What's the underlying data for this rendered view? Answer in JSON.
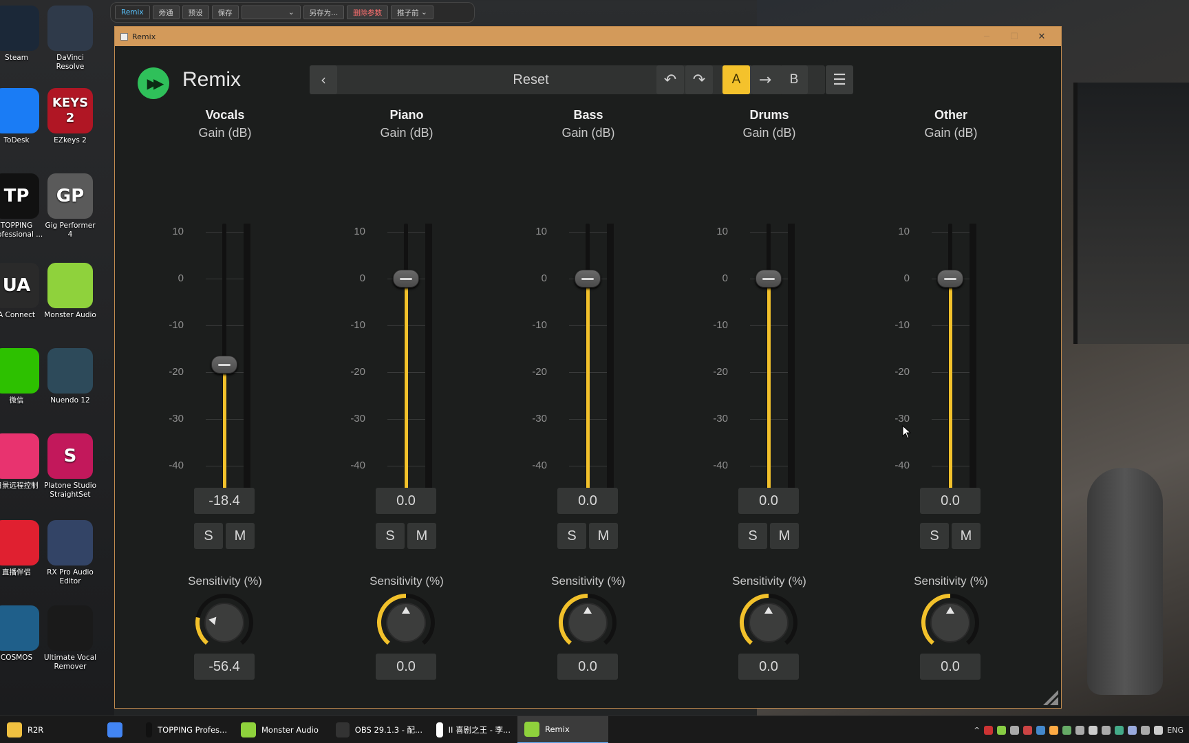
{
  "desktop": {
    "icons": [
      {
        "label": "Steam",
        "abbr": "",
        "color": "#1b2838"
      },
      {
        "label": "DaVinci Resolve",
        "abbr": "",
        "color": "#2f3a4a"
      },
      {
        "label": "ToDesk",
        "abbr": "",
        "color": "#1a7cf5"
      },
      {
        "label": "EZkeys 2",
        "abbr": "KEYS 2",
        "color": "#b01624"
      },
      {
        "label": "TOPPING Professional ...",
        "abbr": "TP",
        "color": "#111111"
      },
      {
        "label": "Gig Performer 4",
        "abbr": "GP",
        "color": "#5a5a5a"
      },
      {
        "label": "A Connect",
        "abbr": "UA",
        "color": "#2a2a2a"
      },
      {
        "label": "Monster Audio",
        "abbr": "",
        "color": "#8fd23c"
      },
      {
        "label": "微信",
        "abbr": "",
        "color": "#2dc100"
      },
      {
        "label": "Nuendo 12",
        "abbr": "",
        "color": "#2d4a5a"
      },
      {
        "label": "日景远程控制",
        "abbr": "",
        "color": "#e8336f"
      },
      {
        "label": "Platone Studio StraightSet",
        "abbr": "S",
        "color": "#c2185b"
      },
      {
        "label": "直播伴侣",
        "abbr": "",
        "color": "#e02030"
      },
      {
        "label": "RX Pro Audio Editor",
        "abbr": "",
        "color": "#334466"
      },
      {
        "label": "COSMOS",
        "abbr": "",
        "color": "#1f5f8a"
      },
      {
        "label": "Ultimate Vocal Remover",
        "abbr": "",
        "color": "#1a1a1a"
      }
    ]
  },
  "host_bar": {
    "buttons": [
      "Remix",
      "旁通",
      "预设",
      "保存",
      "",
      "另存为...",
      "删除参数",
      "推子前"
    ]
  },
  "window": {
    "title": "Remix",
    "controls": {
      "minimize": "─",
      "maximize": "☐",
      "close": "✕"
    }
  },
  "plugin": {
    "name": "Remix",
    "preset": "Reset",
    "buttons": {
      "prev": "‹",
      "next": "›",
      "search": "search-icon",
      "undo": "↶",
      "redo": "↷",
      "ab_a": "A",
      "ab_copy": "→",
      "ab_b": "B",
      "menu": "☰"
    },
    "accent": "#f2c12b",
    "logo_color": "#2fc05a"
  },
  "scale": [
    "10",
    "0",
    "-10",
    "-20",
    "-30",
    "-40"
  ],
  "meter_dash": "--",
  "channels": [
    {
      "name": "Vocals",
      "unit": "Gain (dB)",
      "gain": "-18.4",
      "gain_db": -18.4,
      "solo": "S",
      "mute": "M",
      "sens_label": "Sensitivity (%)",
      "sensitivity": "-56.4",
      "sens_pct": -56.4
    },
    {
      "name": "Piano",
      "unit": "Gain (dB)",
      "gain": "0.0",
      "gain_db": 0,
      "solo": "S",
      "mute": "M",
      "sens_label": "Sensitivity (%)",
      "sensitivity": "0.0",
      "sens_pct": 0
    },
    {
      "name": "Bass",
      "unit": "Gain (dB)",
      "gain": "0.0",
      "gain_db": 0,
      "solo": "S",
      "mute": "M",
      "sens_label": "Sensitivity (%)",
      "sensitivity": "0.0",
      "sens_pct": 0
    },
    {
      "name": "Drums",
      "unit": "Gain (dB)",
      "gain": "0.0",
      "gain_db": 0,
      "solo": "S",
      "mute": "M",
      "sens_label": "Sensitivity (%)",
      "sensitivity": "0.0",
      "sens_pct": 0
    },
    {
      "name": "Other",
      "unit": "Gain (dB)",
      "gain": "0.0",
      "gain_db": 0,
      "solo": "S",
      "mute": "M",
      "sens_label": "Sensitivity (%)",
      "sensitivity": "0.0",
      "sens_pct": 0
    }
  ],
  "taskbar": {
    "items": [
      {
        "label": "R2R",
        "icon": "folder-icon",
        "color": "#f0c040",
        "active": false
      },
      {
        "label": "",
        "icon": "chrome-icon",
        "color": "#4285f4",
        "active": false
      },
      {
        "label": "TOPPING Profes...",
        "icon": "topping-icon",
        "color": "#111111",
        "active": false
      },
      {
        "label": "Monster Audio",
        "icon": "monster-audio-icon",
        "color": "#8fd23c",
        "active": false
      },
      {
        "label": "OBS 29.1.3 - 配...",
        "icon": "obs-icon",
        "color": "#333333",
        "active": false
      },
      {
        "label": "II 喜剧之王 - 李...",
        "icon": "music-icon",
        "color": "#ffffff",
        "active": false
      },
      {
        "label": "Remix",
        "icon": "remix-icon",
        "color": "#8fd23c",
        "active": true
      }
    ],
    "tray_lang": "ENG"
  }
}
